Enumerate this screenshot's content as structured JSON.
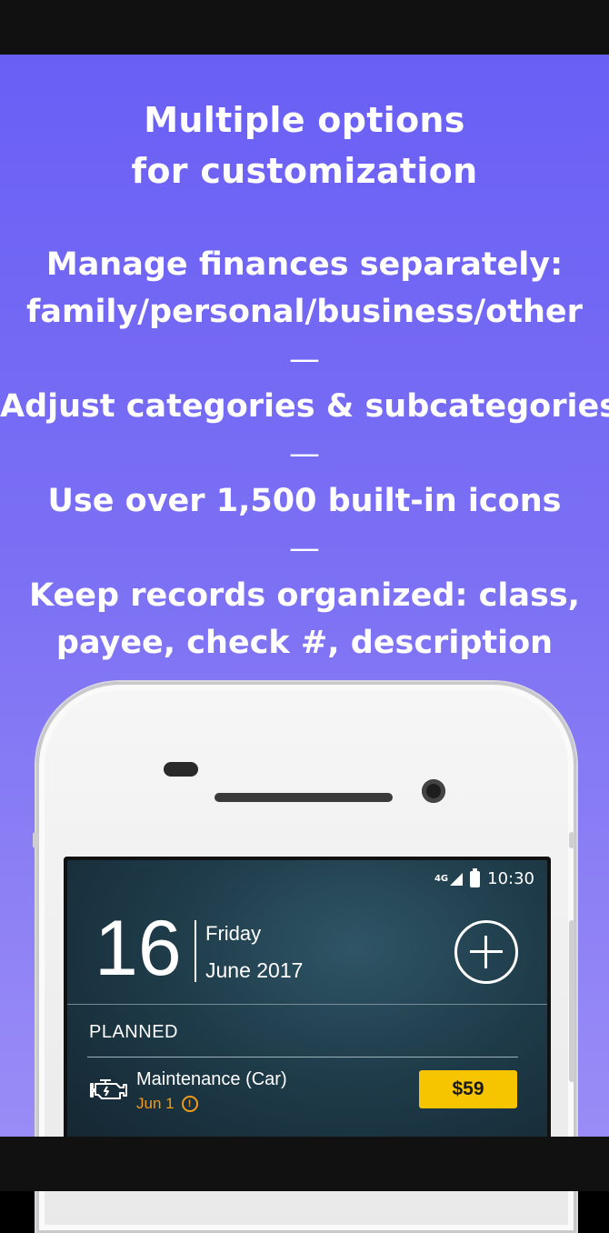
{
  "promo": {
    "headline": [
      "Multiple options",
      "for customization"
    ],
    "features": [
      [
        "Manage finances separately:",
        "family/personal/business/other"
      ],
      [
        "Adjust categories & subcategories"
      ],
      [
        "Use over 1,500 built-in icons"
      ],
      [
        "Keep records organized: class,",
        "payee, check #, description"
      ]
    ],
    "separator": "—"
  },
  "phone_screen": {
    "status_bar": {
      "network": "4G",
      "time": "10:30"
    },
    "date": {
      "day": "16",
      "weekday": "Friday",
      "month_year": "June 2017"
    },
    "section_title": "PLANNED",
    "planned_item": {
      "title": "Maintenance (Car)",
      "date": "Jun 1",
      "amount": "$59",
      "icon": "engine-icon",
      "alert_icon": "alert-circle-icon"
    },
    "colors": {
      "amount_badge": "#f6c500",
      "due_date": "#f29b17",
      "background": "#6a5ff5"
    }
  }
}
